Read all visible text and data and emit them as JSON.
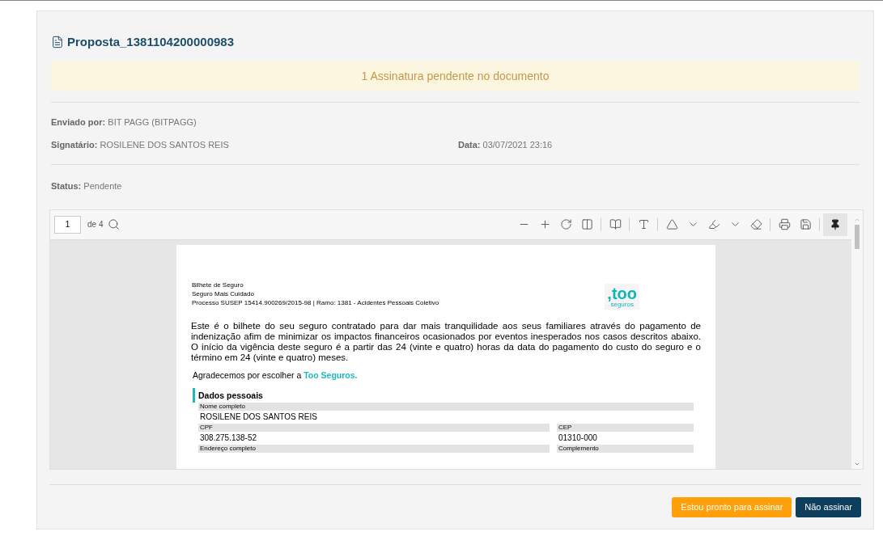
{
  "document": {
    "title": "Proposta_1381104200000983"
  },
  "banner": "1 Assinatura pendente no documento",
  "details": [
    {
      "label": "Enviado por:",
      "value": "BIT PAGG (BITPAGG)"
    },
    {
      "label": "Signatário:",
      "value": "ROSILENE DOS SANTOS REIS"
    },
    {
      "label": "Data:",
      "value": "03/07/2021 23:16"
    }
  ],
  "status": {
    "label": "Status:",
    "value": "Pendente"
  },
  "viewer": {
    "page": "1",
    "of": "de 4",
    "pin_selected": true
  },
  "pdf": {
    "header": [
      "Bilhete de Seguro",
      "Seguro Mais Cuidado",
      "Processo SUSEP 15414.900269/2015-98 | Ramo: 1381 - Acidentes Pessoais Coletivo"
    ],
    "logo": {
      "brand": ",too",
      "sub": "seguros"
    },
    "intro": "Este é o bilhete do seu seguro contratado para dar mais tranquilidade aos seus familiares através do pagamento de indenização afim de minimizar os impactos financeiros ocasionados por eventos inesperados nos casos descritos abaixo. O início da vigência deste seguro é a partir das 24 (vinte e quatro) horas da data do pagamento do custo do seguro e o término em 24 (vinte e quatro) meses.",
    "thanks": "Agradecemos por escolher a",
    "thanks_brand": "Too Seguros.",
    "section": "Dados pessoais",
    "rows": [
      [
        {
          "label": "Nome completo",
          "value": "ROSILENE DOS SANTOS REIS"
        }
      ],
      [
        {
          "label": "CPF",
          "value": "308.275.138-52"
        },
        {
          "label": "CEP",
          "value": "01310-000"
        }
      ],
      [
        {
          "label": "Endereço completo"
        },
        {
          "label": "Complemento"
        }
      ]
    ]
  },
  "buttons": [
    {
      "label": "Estou pronto para assinar",
      "kind": "primary"
    },
    {
      "label": "Não assinar",
      "kind": "secondary"
    }
  ]
}
